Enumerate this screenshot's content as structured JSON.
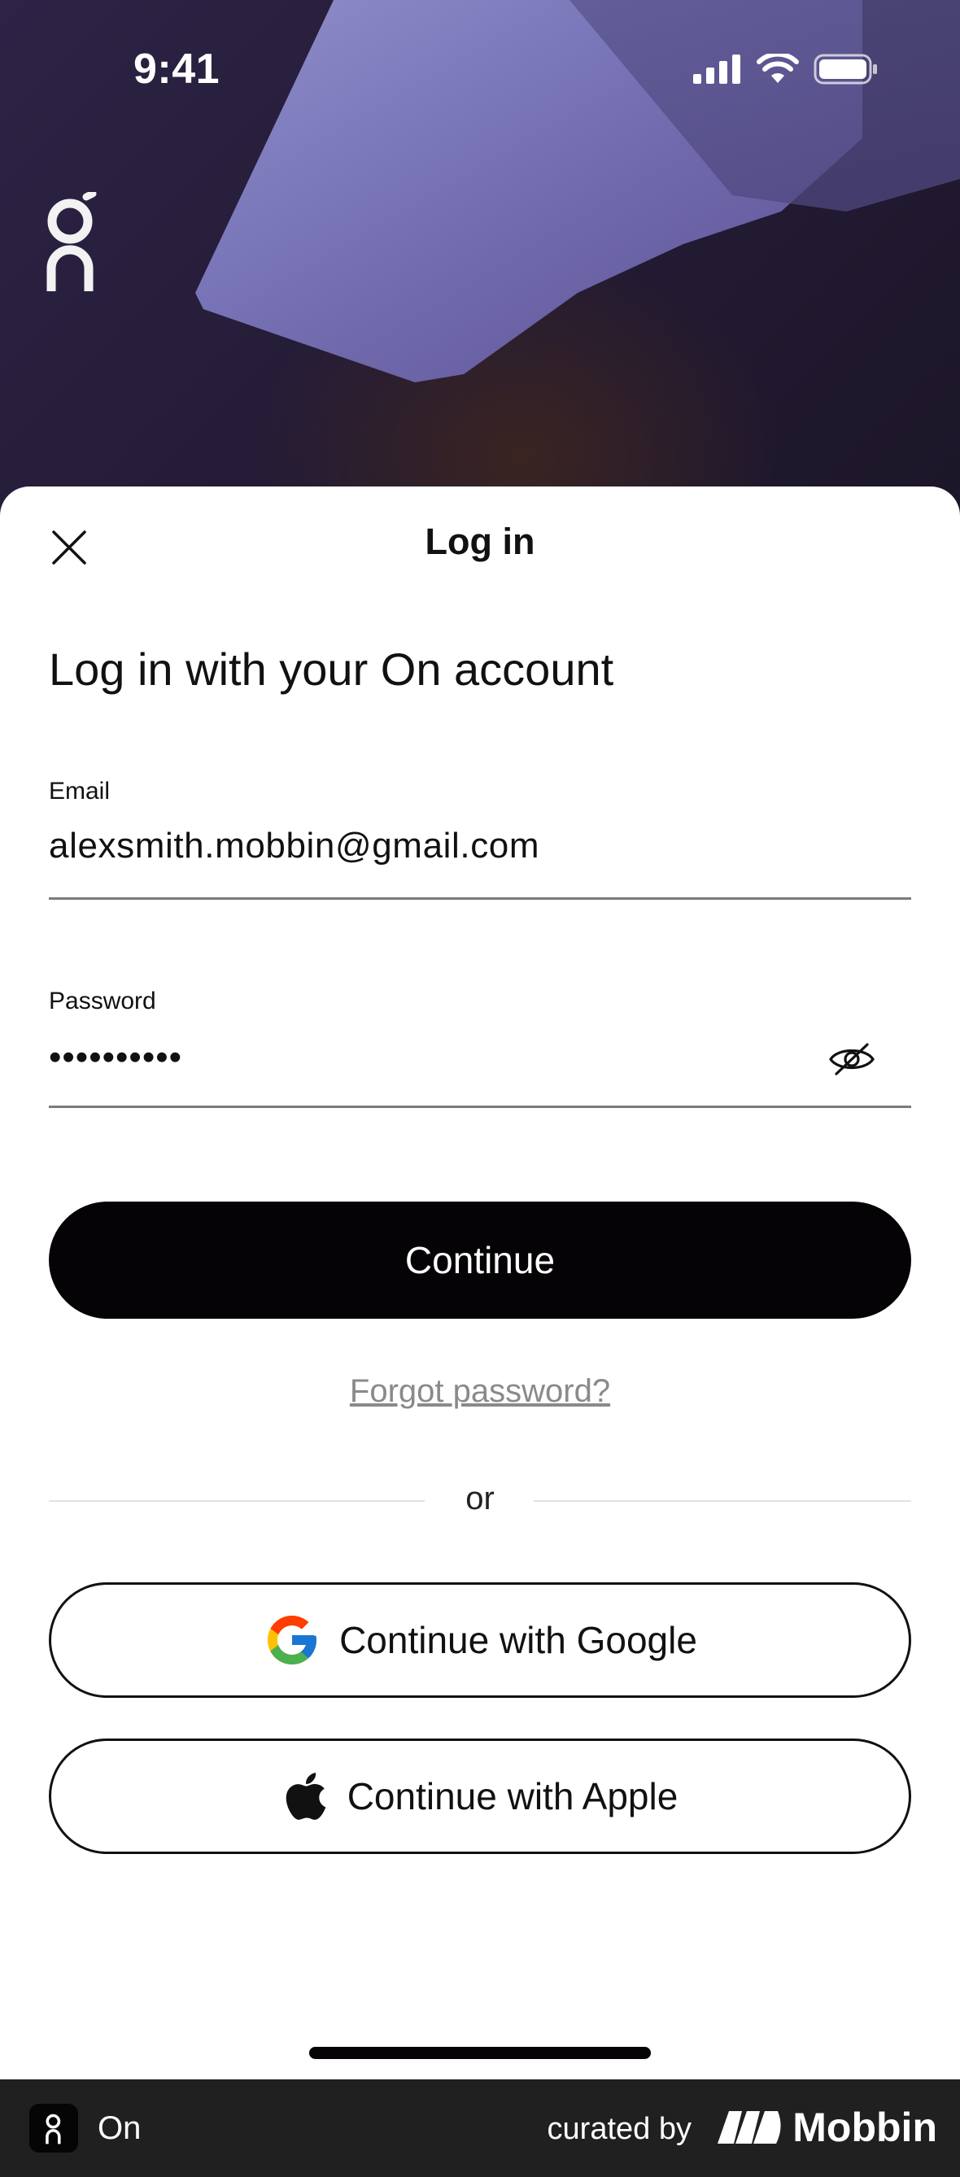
{
  "status_bar": {
    "time": "9:41"
  },
  "sheet": {
    "title": "Log in",
    "heading": "Log in with your On account"
  },
  "email": {
    "label": "Email",
    "value": "alexsmith.mobbin@gmail.com"
  },
  "password": {
    "label": "Password",
    "value": "••••••••••"
  },
  "buttons": {
    "continue": "Continue",
    "forgot": "Forgot password?",
    "or": "or",
    "google": "Continue with Google",
    "apple": "Continue with Apple"
  },
  "footer": {
    "app_name": "On",
    "curated_by": "curated by",
    "brand": "Mobbin"
  },
  "colors": {
    "primary": "#050305",
    "sheet": "#ffffff",
    "footer": "#202020",
    "hero": "#2d2346"
  }
}
